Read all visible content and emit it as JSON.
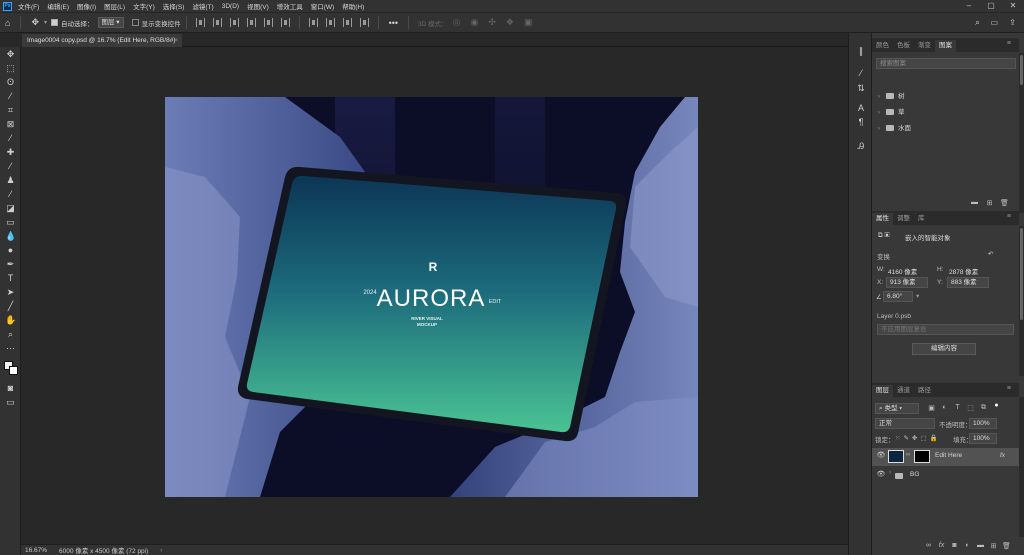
{
  "menubar": {
    "app_icon": "Ps",
    "items": [
      "文件(F)",
      "编辑(E)",
      "图像(I)",
      "图层(L)",
      "文字(Y)",
      "选择(S)",
      "滤镜(T)",
      "3D(D)",
      "视图(V)",
      "增效工具",
      "窗口(W)",
      "帮助(H)"
    ]
  },
  "options": {
    "auto_select_label": "自动选择：",
    "auto_select_target": "图层",
    "show_transform_label": "显示变换控件",
    "mode3d_label": "3D 模式："
  },
  "document": {
    "tab_title": "Image0004 copy.psd @ 16.7% (Edit Here, RGB/8#)"
  },
  "artwork": {
    "logo_glyph": "R",
    "left_text": "2024",
    "title": "AURORA",
    "right_text": "EDIT",
    "sub_line1": "RIVER VISUAL",
    "sub_line2": "MOCKUP"
  },
  "status": {
    "zoom": "16.67%",
    "dimensions": "6000 像素 x 4500 像素 (72 ppi)"
  },
  "panel_top": {
    "tabs": [
      "颜色",
      "色板",
      "渐变",
      "图案"
    ],
    "active_tab": "图案",
    "search_placeholder": "搜索图案",
    "groups": [
      "树",
      "草",
      "水面"
    ]
  },
  "properties": {
    "tabs": [
      "属性",
      "调整",
      "库"
    ],
    "active_tab": "属性",
    "type_label": "嵌入的智能对象",
    "transform_label": "变换",
    "w_label": "W:",
    "w_value": "4160 像素",
    "h_label": "H:",
    "h_value": "2878 像素",
    "x_label": "X:",
    "x_value": "913 像素",
    "y_label": "Y:",
    "y_value": "883 像素",
    "angle_value": "6.80°",
    "file_label": "Layer 0.psb",
    "comp_placeholder": "不应用图层复合",
    "edit_button": "编辑内容"
  },
  "layers": {
    "tabs": [
      "图层",
      "通道",
      "路径"
    ],
    "active_tab": "图层",
    "filter_type": "类型",
    "blend_mode": "正常",
    "opacity_label": "不透明度：",
    "opacity_value": "100%",
    "lock_label": "锁定：",
    "fill_label": "填充：",
    "fill_value": "100%",
    "items": [
      {
        "name": "Edit Here",
        "fx": "fx"
      },
      {
        "name": "BG"
      }
    ]
  },
  "colors": {
    "accent": "#31a8ff",
    "panel_bg": "#383838",
    "ui_bg": "#323232",
    "canvas_bg": "#282828",
    "selected_row": "#525252"
  }
}
